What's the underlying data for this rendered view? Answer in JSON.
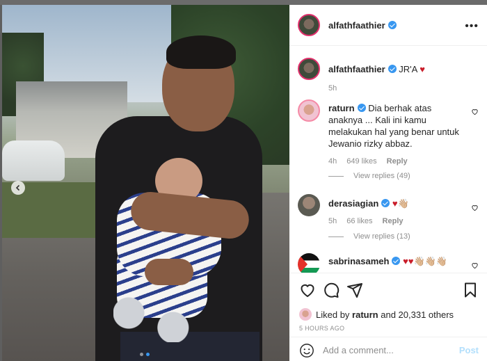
{
  "post": {
    "username": "alfathfaathier",
    "more_label": "•••"
  },
  "caption": {
    "username": "alfathfaathier",
    "text": "JR'A",
    "emoji": "♥",
    "time": "5h"
  },
  "comments": [
    {
      "username": "raturn",
      "text": "Dia berhak atas anaknya ... Kali ini kamu melakukan hal yang benar untuk Jewanio rizky abbaz.",
      "time": "4h",
      "likes": "649 likes",
      "reply": "Reply",
      "view_replies": "View replies (49)"
    },
    {
      "username": "derasiagian",
      "text": "♥👋🏼",
      "time": "5h",
      "likes": "66 likes",
      "reply": "Reply",
      "view_replies": "View replies (13)"
    },
    {
      "username": "sabrinasameh",
      "text": "♥♥👋🏼👋🏼👋🏼"
    }
  ],
  "liked_by": {
    "prefix": "Liked by",
    "user": "raturn",
    "suffix": "and 20,331 others"
  },
  "timestamp": "5 HOURS AGO",
  "add_comment": {
    "placeholder": "Add a comment...",
    "post_label": "Post"
  },
  "carousel": {
    "slide_count": 2,
    "active": 1
  }
}
